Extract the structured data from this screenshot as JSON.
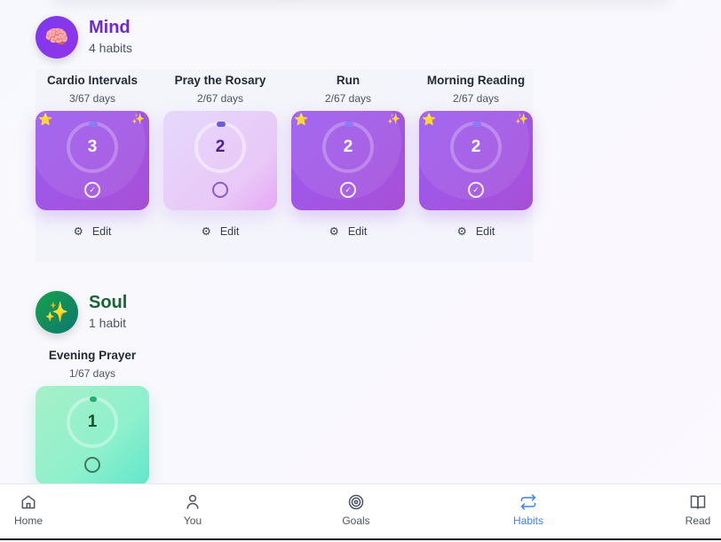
{
  "categories": [
    {
      "title": "Mind",
      "count": "4 habits",
      "icon": "brain-icon",
      "emoji": "🧠",
      "color": "#6d28d9",
      "habits": [
        {
          "name": "Cardio Intervals",
          "days": "3/67 days",
          "value": "3",
          "progress": 0.045,
          "completed": true,
          "edit": "Edit"
        },
        {
          "name": "Pray the Rosary",
          "days": "2/67 days",
          "value": "2",
          "progress": 0.03,
          "completed": false,
          "edit": "Edit"
        },
        {
          "name": "Run",
          "days": "2/67 days",
          "value": "2",
          "progress": 0.03,
          "completed": true,
          "edit": "Edit"
        },
        {
          "name": "Morning Reading",
          "days": "2/67 days",
          "value": "2",
          "progress": 0.03,
          "completed": true,
          "edit": "Edit"
        }
      ]
    },
    {
      "title": "Soul",
      "count": "1 habit",
      "icon": "sparkles-icon",
      "emoji": "✨",
      "color": "#166534",
      "habits": [
        {
          "name": "Evening Prayer",
          "days": "1/67 days",
          "value": "1",
          "progress": 0.015,
          "completed": false
        }
      ]
    }
  ],
  "nav": [
    {
      "label": "Home",
      "icon": "home-icon"
    },
    {
      "label": "You",
      "icon": "user-icon"
    },
    {
      "label": "Goals",
      "icon": "target-icon"
    },
    {
      "label": "Habits",
      "icon": "repeat-icon",
      "active": true
    },
    {
      "label": "Read",
      "icon": "book-icon"
    }
  ],
  "colors": {
    "accent": "#3b82f6",
    "mind": "#6d28d9",
    "soul": "#166534"
  }
}
